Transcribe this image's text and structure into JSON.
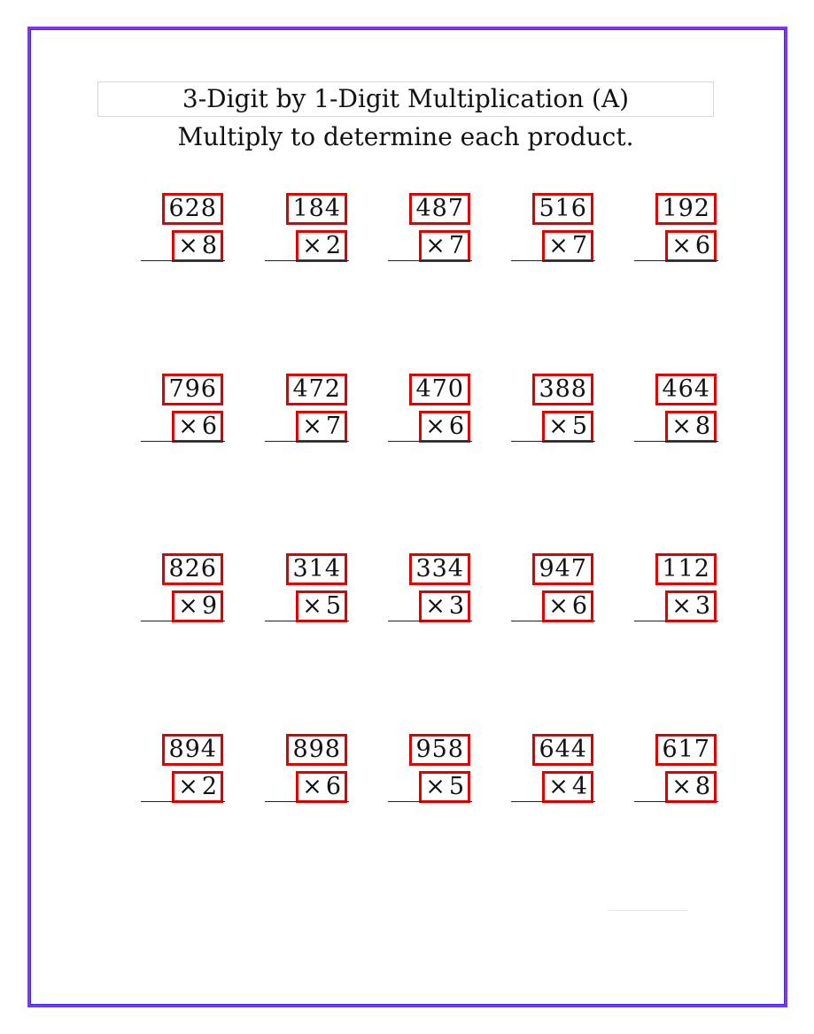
{
  "worksheet": {
    "title": "3-Digit by 1-Digit Multiplication (A)",
    "subtitle": "Multiply to determine each product.",
    "times_symbol": "×",
    "frame_color": "#7a35ff",
    "highlight_color": "#e00000"
  },
  "rows": [
    [
      {
        "top": "628",
        "mult": "8"
      },
      {
        "top": "184",
        "mult": "2"
      },
      {
        "top": "487",
        "mult": "7"
      },
      {
        "top": "516",
        "mult": "7"
      },
      {
        "top": "192",
        "mult": "6"
      }
    ],
    [
      {
        "top": "796",
        "mult": "6"
      },
      {
        "top": "472",
        "mult": "7"
      },
      {
        "top": "470",
        "mult": "6"
      },
      {
        "top": "388",
        "mult": "5"
      },
      {
        "top": "464",
        "mult": "8"
      }
    ],
    [
      {
        "top": "826",
        "mult": "9"
      },
      {
        "top": "314",
        "mult": "5"
      },
      {
        "top": "334",
        "mult": "3"
      },
      {
        "top": "947",
        "mult": "6"
      },
      {
        "top": "112",
        "mult": "3"
      }
    ],
    [
      {
        "top": "894",
        "mult": "2"
      },
      {
        "top": "898",
        "mult": "6"
      },
      {
        "top": "958",
        "mult": "5"
      },
      {
        "top": "644",
        "mult": "4"
      },
      {
        "top": "617",
        "mult": "8"
      }
    ]
  ]
}
